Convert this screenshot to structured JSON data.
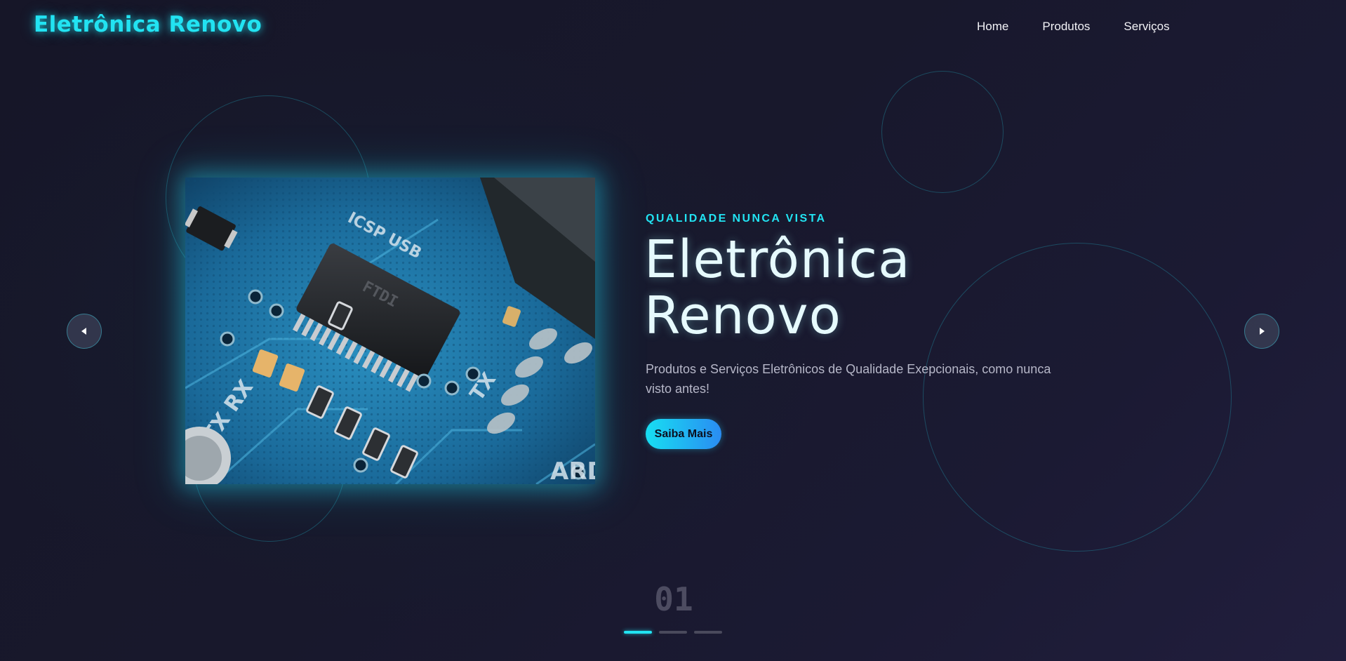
{
  "header": {
    "logo": "Eletrônica Renovo",
    "nav": [
      "Home",
      "Produtos",
      "Serviços"
    ]
  },
  "hero": {
    "eyebrow": "QUALIDADE NUNCA VISTA",
    "title_line1": "Eletrônica",
    "title_line2": "Renovo",
    "description": "Produtos e Serviços Eletrônicos de Qualidade Exepcionais, como nunca visto antes!",
    "cta_label": "Saiba Mais",
    "image_alt_icon": "circuit-board-photo"
  },
  "carousel": {
    "current_slide": "01",
    "slide_count": 3,
    "active_index": 0,
    "prev_icon": "caret-left-icon",
    "next_icon": "caret-right-icon"
  },
  "colors": {
    "accent": "#22e3f2",
    "background": "#16162a",
    "cta_gradient_start": "#17dff2",
    "cta_gradient_end": "#2a8cf2"
  }
}
